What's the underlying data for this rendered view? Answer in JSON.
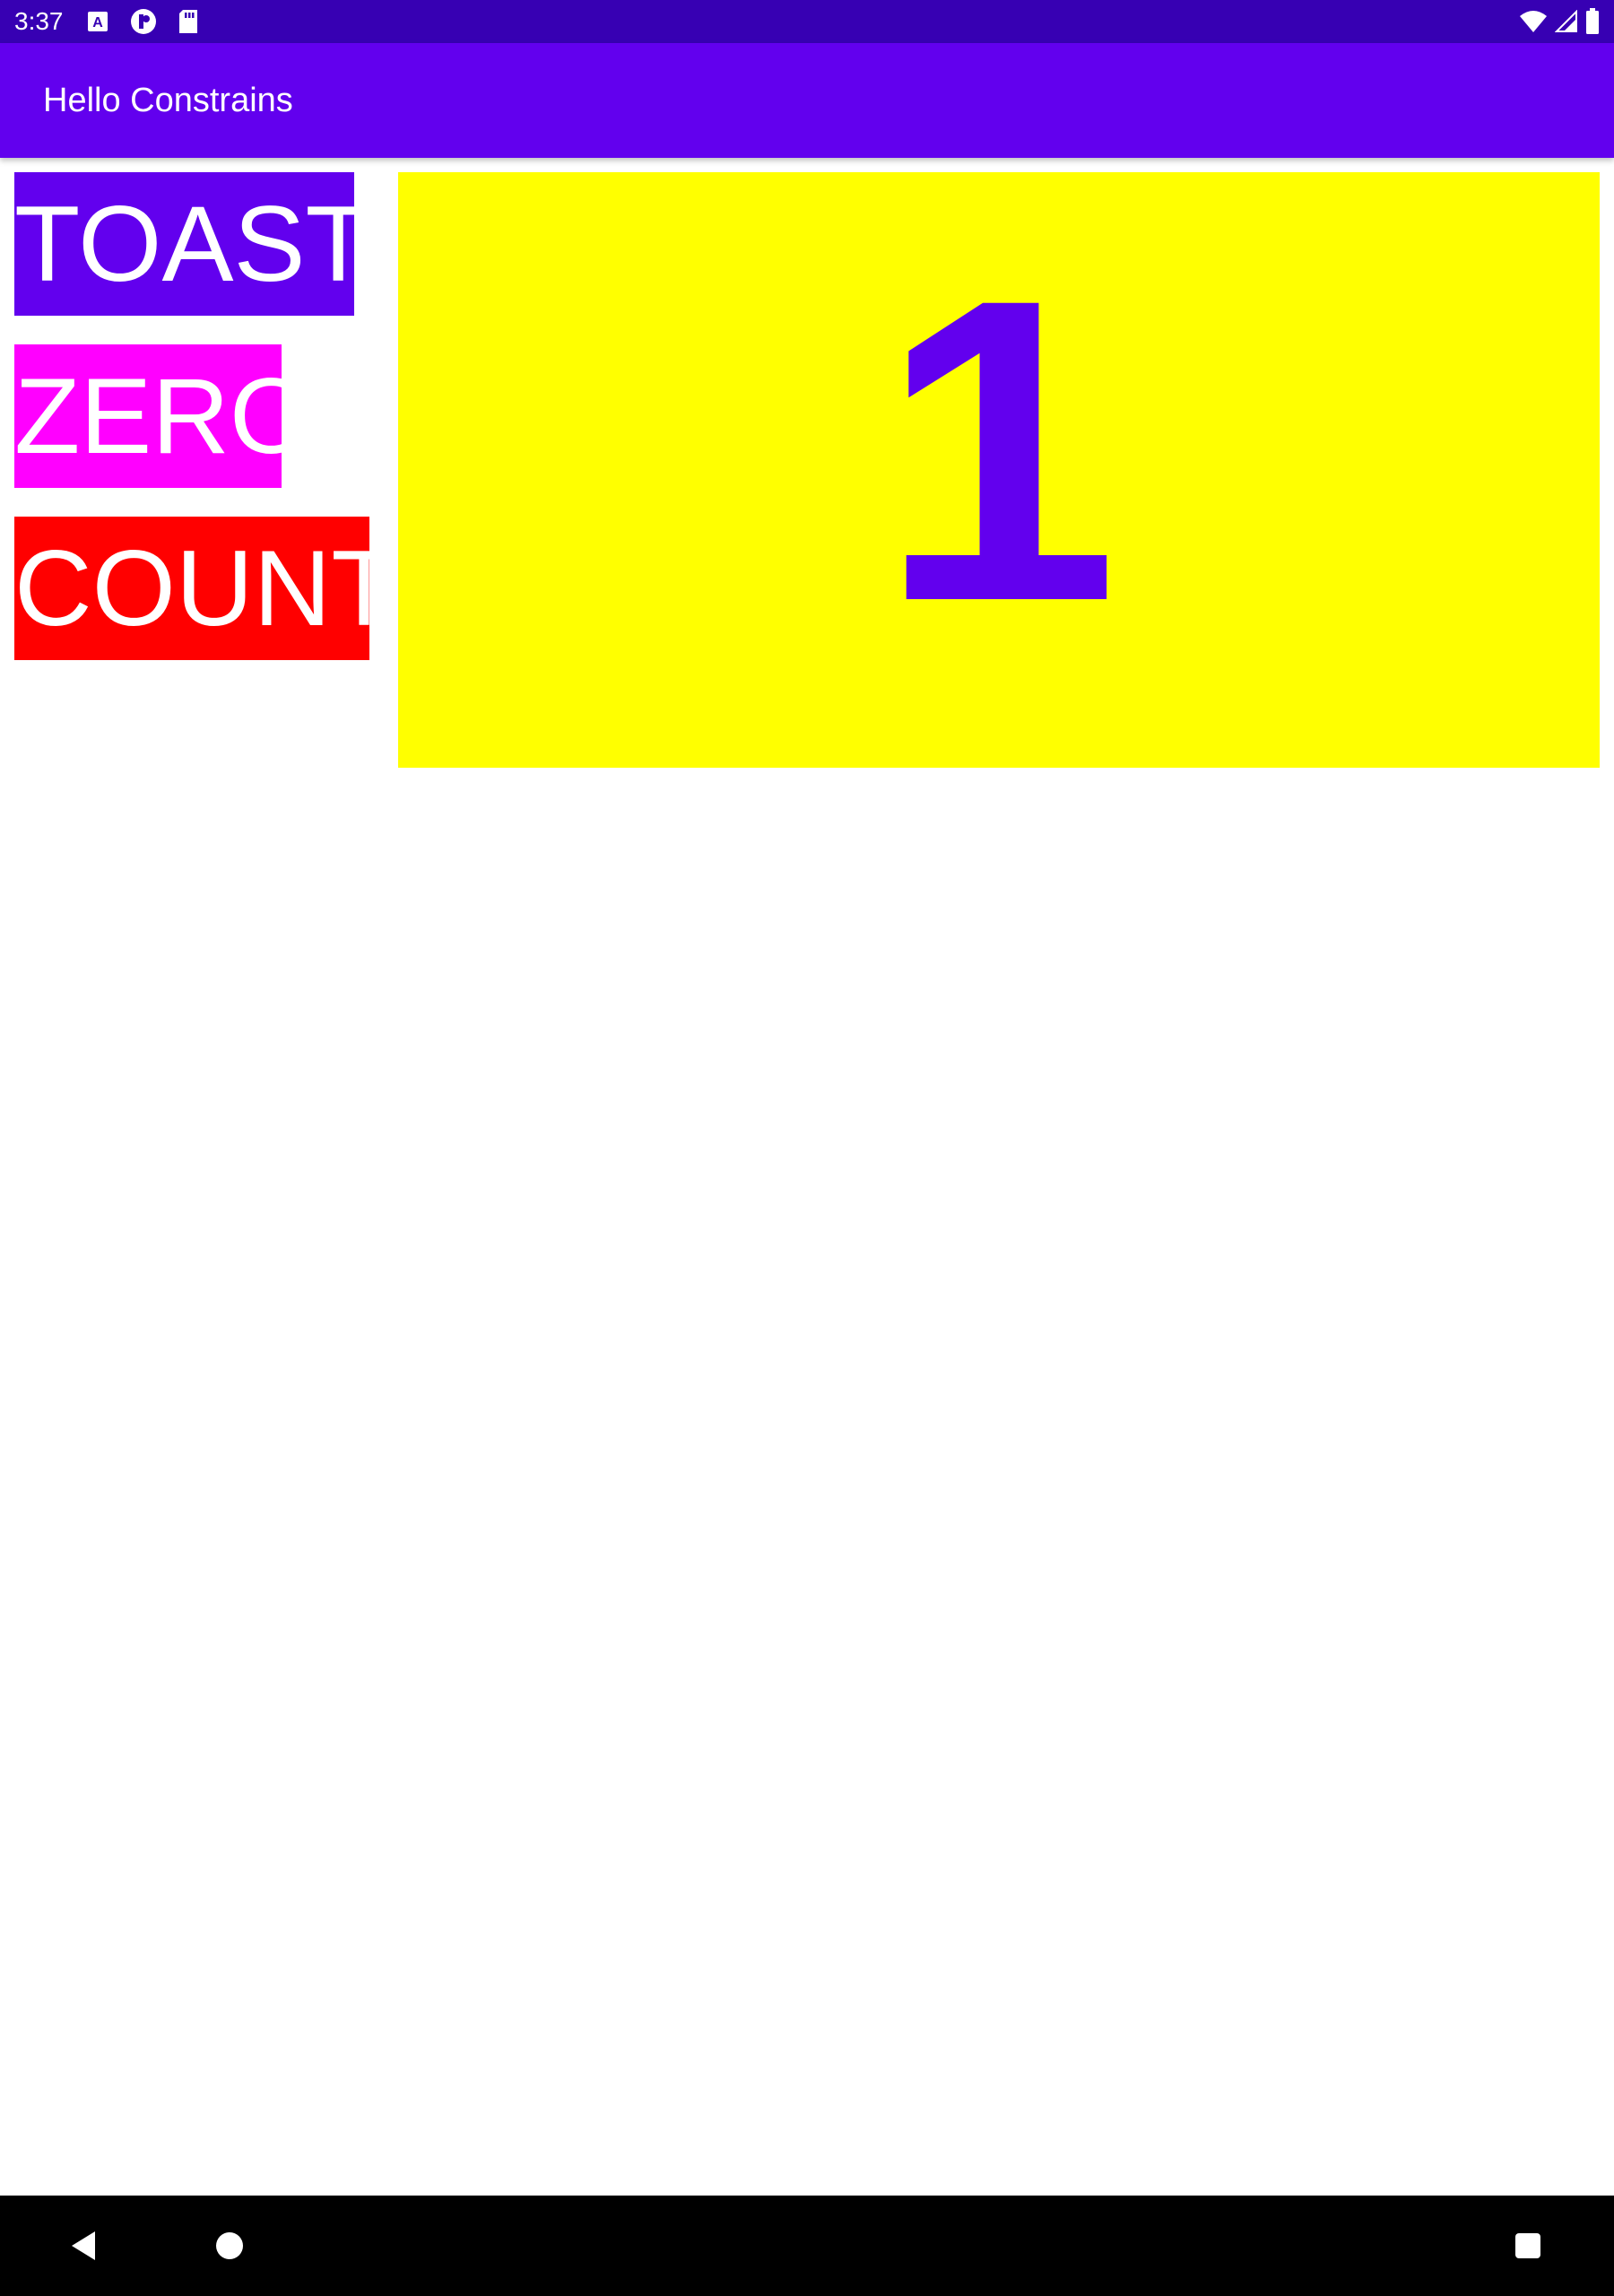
{
  "status_bar": {
    "time": "3:37",
    "left_icons": [
      "a-keyboard-icon",
      "notification-app-icon",
      "sd-card-icon"
    ],
    "right_icons": [
      "wifi-icon",
      "cellular-signal-icon",
      "battery-icon"
    ],
    "background": "#3700b3"
  },
  "app_bar": {
    "title": "Hello Constrains",
    "background": "#6200ee"
  },
  "buttons": {
    "toast": {
      "label": "TOAST",
      "background": "#6200ee"
    },
    "zero": {
      "label": "ZERO",
      "background": "#ff00ff"
    },
    "count": {
      "label": "COUNT",
      "background": "#ff0000"
    }
  },
  "counter": {
    "value": "1",
    "background": "#ffff00",
    "text_color": "#6200ee"
  },
  "nav_bar": {
    "icons": [
      "back-icon",
      "home-icon",
      "recents-icon"
    ]
  }
}
